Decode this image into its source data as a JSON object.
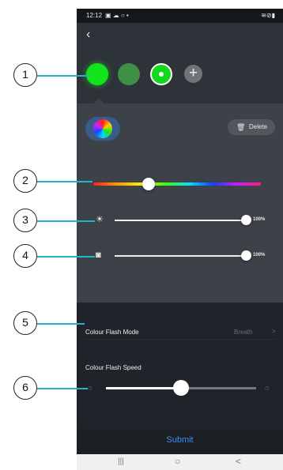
{
  "status_bar": {
    "time": "12:12",
    "left_icons": "▣ ☁ ○ •",
    "right_icons": "≋⊘▮"
  },
  "colors": {
    "swatch_1": "#12e31b",
    "swatch_2": "#3f9044",
    "swatch_3": "#12d71b",
    "accent": "#3b8ff2",
    "leader_line": "#27b3c6"
  },
  "header": {
    "back_icon": "chevron-left-icon",
    "back_glyph": "‹",
    "add_glyph": "+"
  },
  "color_panel": {
    "delete_label": "Delete",
    "trash_glyph": "🗑",
    "hue_position": 0.33,
    "brightness": {
      "icon_glyph": "☀",
      "value_fraction": 1.0,
      "label": "100%"
    },
    "saturation": {
      "icon_glyph": "◙",
      "value_fraction": 1.0,
      "label": "100%"
    }
  },
  "flash": {
    "mode_label": "Colour Flash Mode",
    "mode_value": "Breath",
    "chevron_glyph": ">",
    "speed_label": "Colour Flash Speed",
    "speed_fraction": 0.5,
    "slow_glyph": "◌",
    "fast_glyph": "◌"
  },
  "submit_label": "Submit",
  "nav": {
    "recents_glyph": "|||",
    "home_glyph": "○",
    "back_glyph": "<"
  },
  "callouts": [
    "1",
    "2",
    "3",
    "4",
    "5",
    "6"
  ]
}
